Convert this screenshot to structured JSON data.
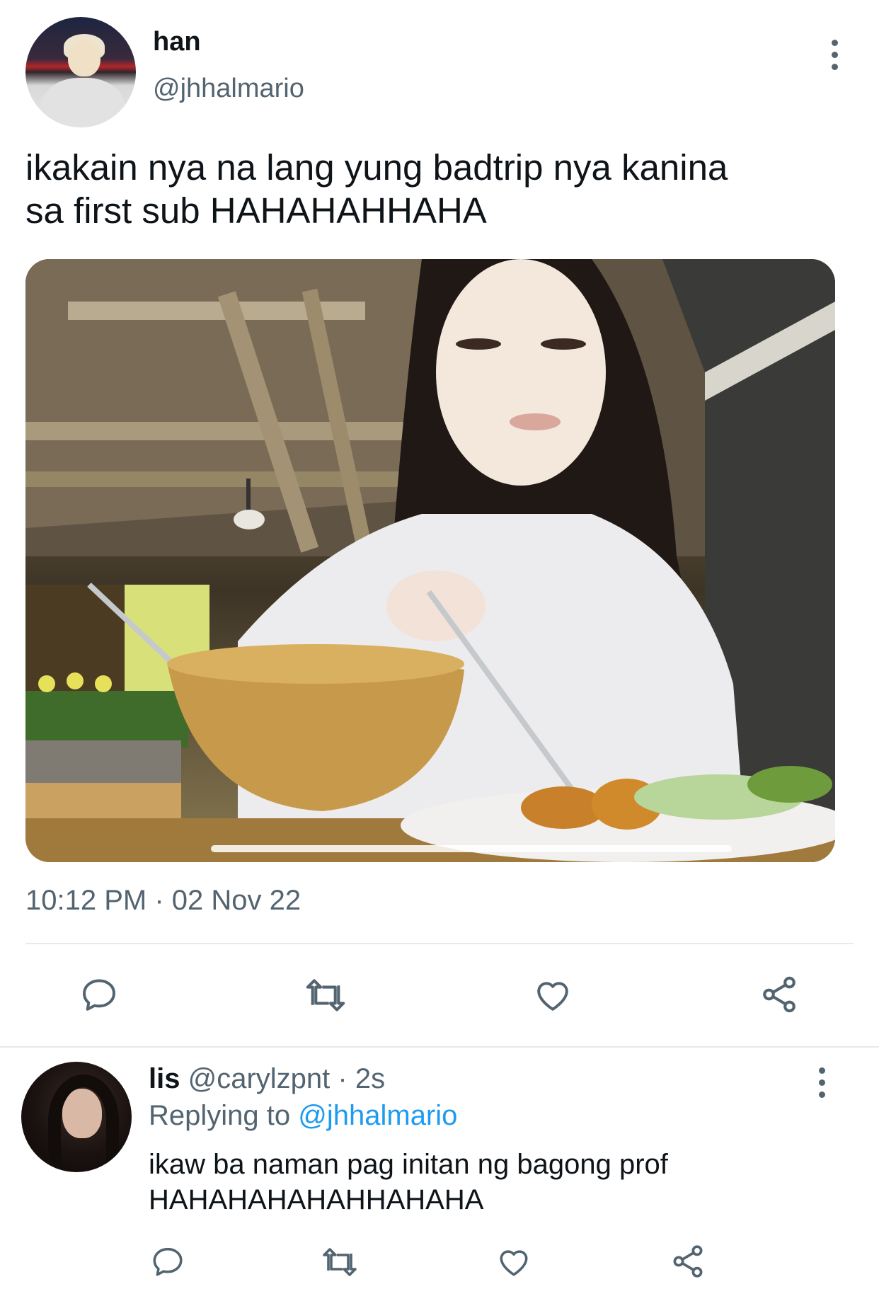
{
  "main_tweet": {
    "author": {
      "name": "han",
      "handle": "@jhhalmario"
    },
    "text_lines": [
      "ikakain nya na lang yung badtrip nya kanina",
      "sa first sub HAHAHAHHAHA"
    ],
    "timestamp": "10:12 PM · 02 Nov 22",
    "media": {
      "video_progress": 0.58
    },
    "actions": [
      "reply-icon",
      "retweet-icon",
      "like-icon",
      "share-icon"
    ]
  },
  "reply": {
    "author": {
      "name": "lis",
      "handle": "@carylzpnt",
      "time": "2s"
    },
    "replying_to_label": "Replying to",
    "replying_to_handle": "@jhhalmario",
    "text_lines": [
      "ikaw ba naman pag initan ng bagong prof",
      "HAHAHAHAHAHHAHAHA"
    ],
    "actions": [
      "reply-icon",
      "retweet-icon",
      "like-icon",
      "share-icon"
    ]
  },
  "colors": {
    "text_primary": "#0f1419",
    "text_secondary": "#536471",
    "link": "#1d9bf0",
    "icon": "#536471",
    "divider": "#e7e9ea"
  }
}
